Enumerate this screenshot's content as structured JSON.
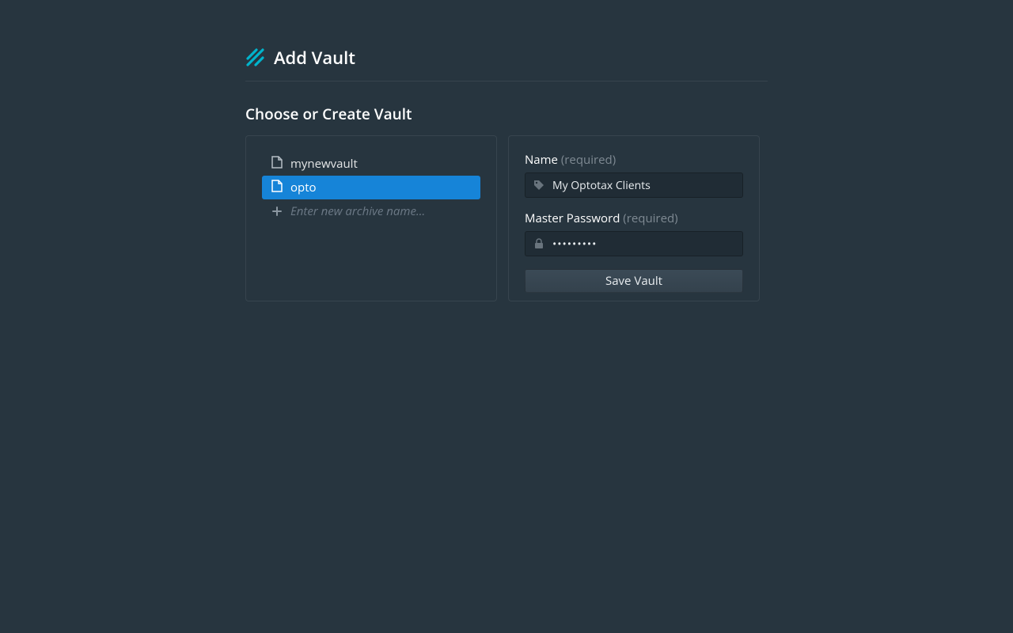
{
  "header": {
    "title": "Add Vault"
  },
  "section": {
    "title": "Choose or Create Vault"
  },
  "vault_list": {
    "items": [
      {
        "label": "mynewvault"
      },
      {
        "label": "opto"
      }
    ],
    "new_placeholder": "Enter new archive name..."
  },
  "form": {
    "name_label": "Name",
    "name_required": "(required)",
    "name_value": "My Optotax Clients",
    "password_label": "Master Password",
    "password_required": "(required)",
    "password_value": "•••••••••",
    "save_label": "Save Vault"
  }
}
